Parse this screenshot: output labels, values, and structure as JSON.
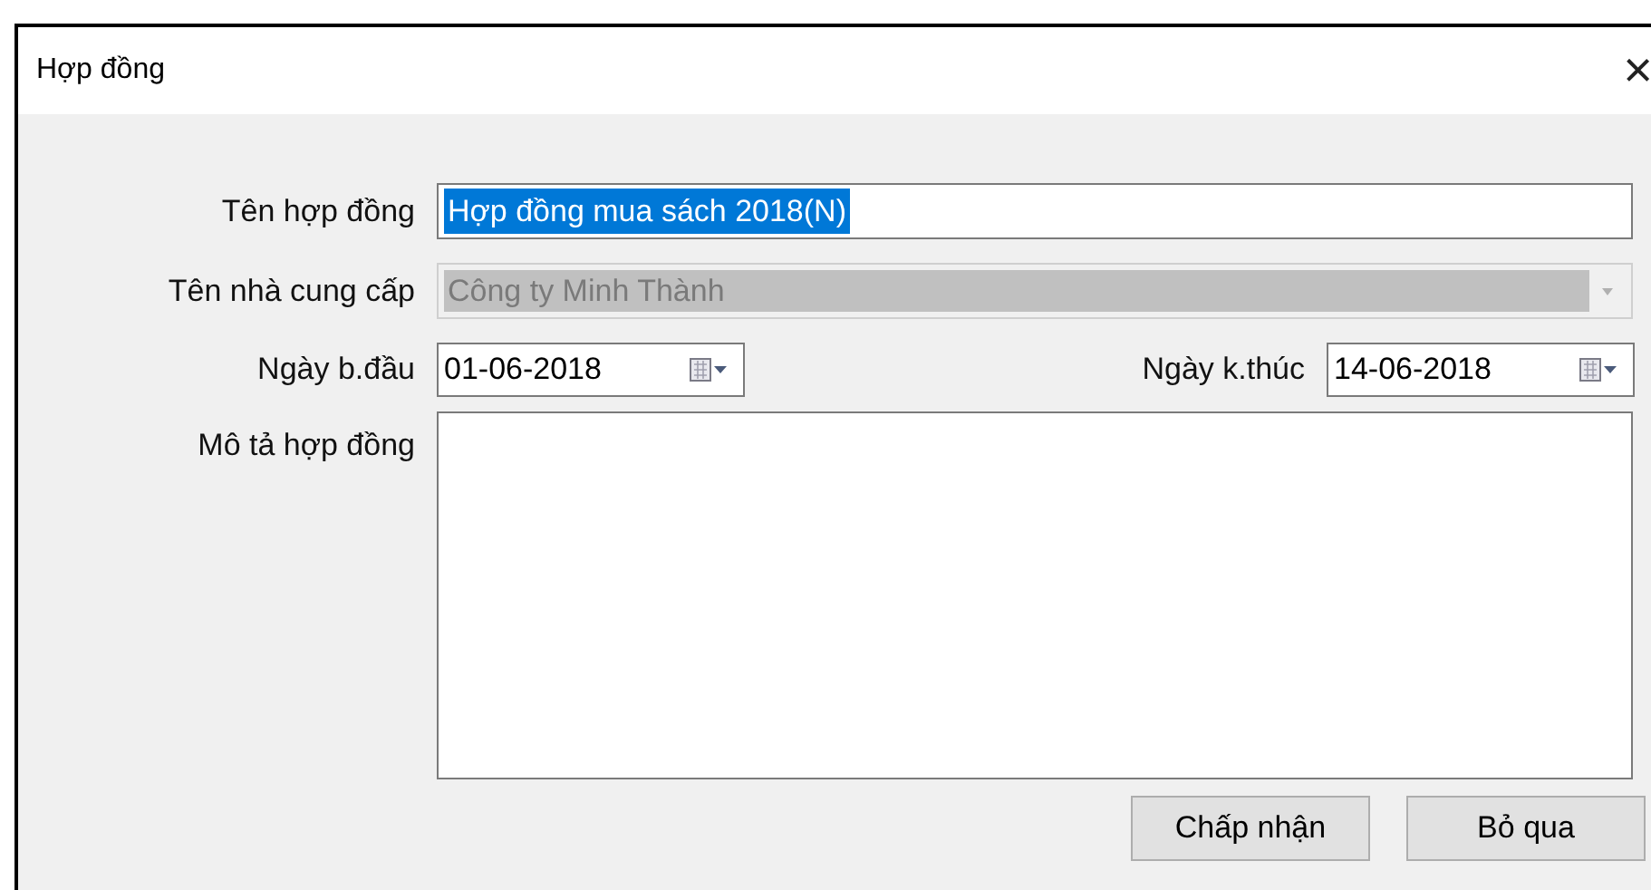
{
  "window": {
    "title": "Hợp đồng",
    "close": "×"
  },
  "fields": [
    {
      "kind": "text",
      "label": "Tên hợp đồng",
      "value": "Hợp đồng mua sách 2018(N)",
      "text_selected": true
    },
    {
      "kind": "combo",
      "label": "Tên nhà cung cấp",
      "value": "Công ty Minh Thành",
      "disabled": true
    }
  ],
  "dates": [
    {
      "label": "Ngày b.đầu",
      "value": "01-06-2018"
    },
    {
      "label": "Ngày k.thúc",
      "value": "14-06-2018"
    }
  ],
  "description": {
    "label": "Mô tả hợp đồng"
  },
  "buttons": [
    "Chấp nhận",
    "Bỏ qua"
  ]
}
